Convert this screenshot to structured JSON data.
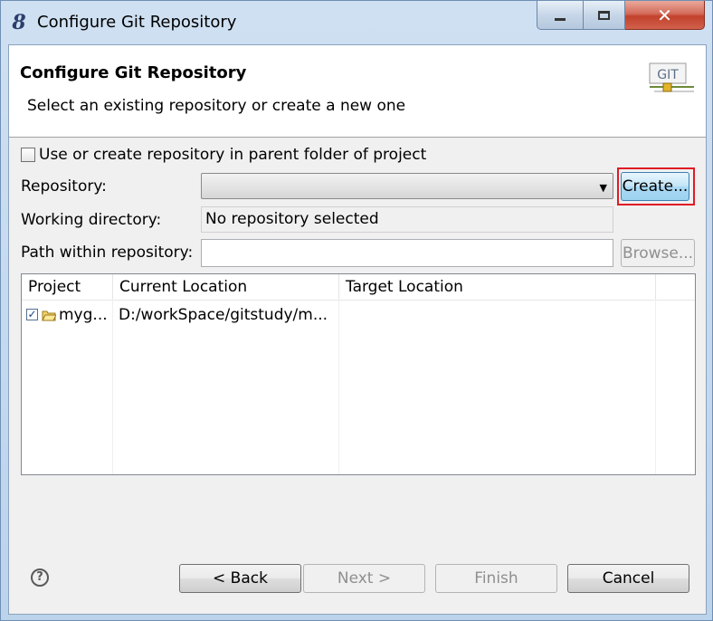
{
  "window": {
    "title": "Configure Git Repository",
    "app_icon_glyph": "8",
    "controls": [
      "minimize",
      "maximize",
      "close"
    ]
  },
  "header": {
    "title": "Configure Git Repository",
    "description": "Select an existing repository or create a new one",
    "logo_text": "GIT"
  },
  "form": {
    "use_parent_checkbox": {
      "label": "Use or create repository in parent folder of project",
      "checked": false
    },
    "repository_label": "Repository:",
    "repository_value": "",
    "create_button": "Create...",
    "working_directory_label": "Working directory:",
    "working_directory_value": "No repository selected",
    "path_label": "Path within repository:",
    "path_value": "",
    "browse_button": "Browse..."
  },
  "table": {
    "columns": [
      "Project",
      "Current Location",
      "Target Location"
    ],
    "rows": [
      {
        "checked": true,
        "project": "myg...",
        "current_location": "D:/workSpace/gitstudy/m...",
        "target_location": ""
      }
    ]
  },
  "footer": {
    "back_button": "< Back",
    "next_button": "Next >",
    "finish_button": "Finish",
    "cancel_button": "Cancel"
  },
  "colors": {
    "highlight_box": "#e01b24",
    "create_button_bg": "#a9d9f4",
    "close_button_bg": "#c2412c"
  }
}
